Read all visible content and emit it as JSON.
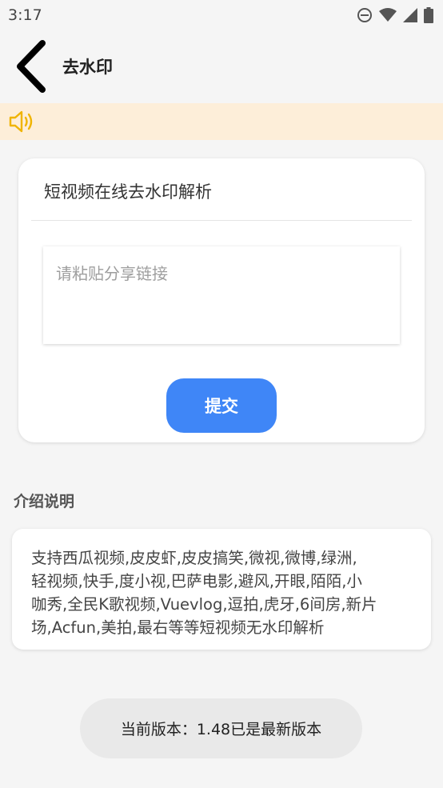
{
  "status_bar": {
    "time": "3:17",
    "icons": [
      "dnd-icon",
      "wifi-icon",
      "signal-icon",
      "battery-icon"
    ]
  },
  "app_bar": {
    "back_icon": "chevron-left-icon",
    "title": "去水印"
  },
  "notice": {
    "icon": "speaker-icon",
    "text": "",
    "background": "#fdeed9",
    "icon_color": "#f0b400"
  },
  "main_card": {
    "title": "短视频在线去水印解析",
    "input": {
      "value": "",
      "placeholder": "请粘贴分享链接"
    },
    "submit_label": "提交"
  },
  "intro": {
    "section_title": "介绍说明",
    "lines": [
      "支持西瓜视频,皮皮虾,皮皮搞笑,微视,微博,绿洲,",
      "轻视频,快手,度小视,巴萨电影,避风,开眼,陌陌,小",
      "咖秀,全民K歌视频,Vuevlog,逗拍,虎牙,6间房,新片",
      "场,Acfun,美拍,最右等等短视频无水印解析"
    ]
  },
  "version": {
    "text": "当前版本：1.48已是最新版本"
  },
  "colors": {
    "accent": "#3f86f7",
    "background": "#f5f5f5",
    "card": "#ffffff"
  }
}
